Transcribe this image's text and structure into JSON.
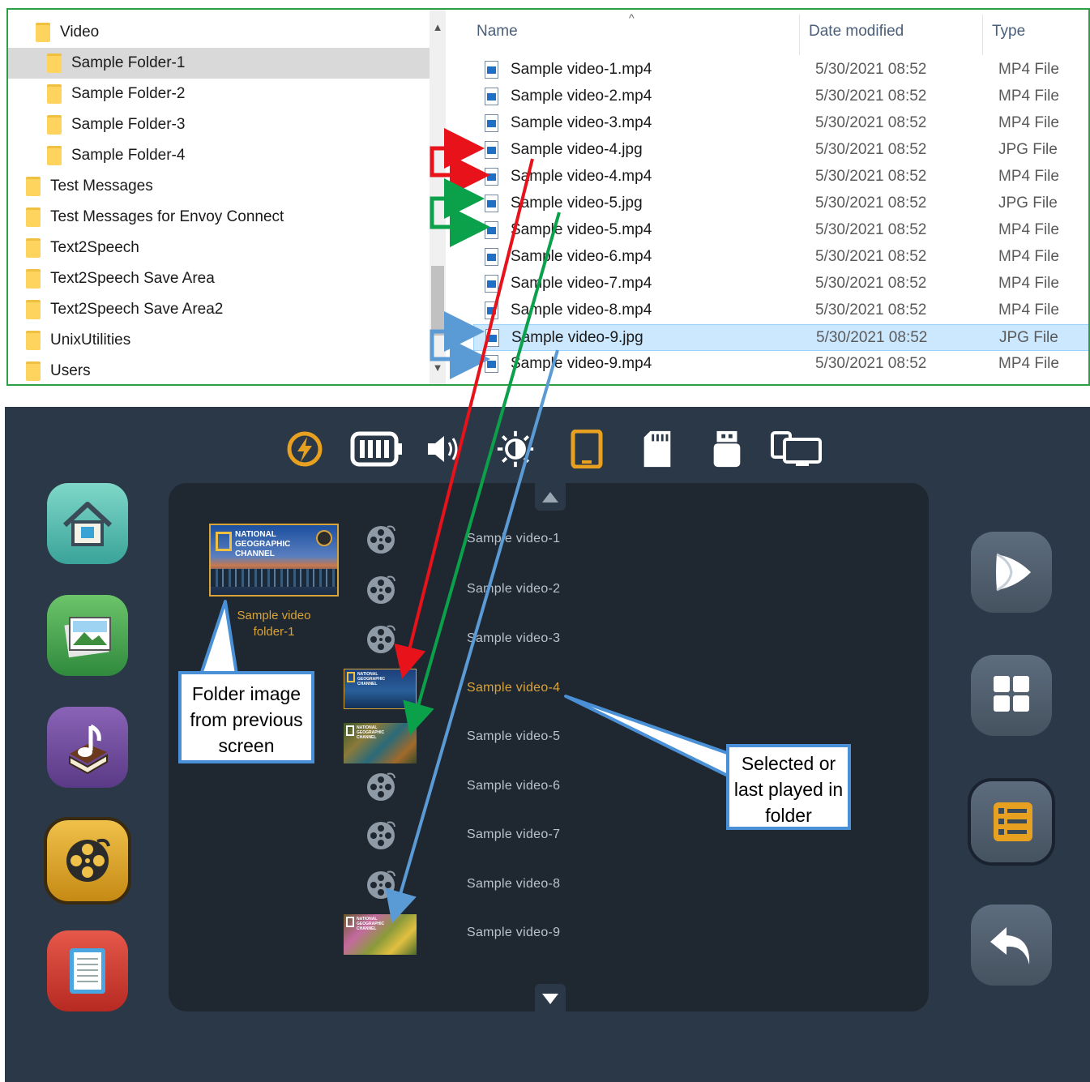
{
  "tree": {
    "items": [
      {
        "label": "Video",
        "level": 0,
        "selected": false
      },
      {
        "label": "Sample Folder-1",
        "level": 1,
        "selected": true
      },
      {
        "label": "Sample Folder-2",
        "level": 1,
        "selected": false
      },
      {
        "label": "Sample Folder-3",
        "level": 1,
        "selected": false
      },
      {
        "label": "Sample Folder-4",
        "level": 1,
        "selected": false
      },
      {
        "label": "Test Messages",
        "level": 0,
        "selected": false
      },
      {
        "label": "Test Messages for Envoy Connect",
        "level": 0,
        "selected": false
      },
      {
        "label": "Text2Speech",
        "level": 0,
        "selected": false
      },
      {
        "label": "Text2Speech Save Area",
        "level": 0,
        "selected": false
      },
      {
        "label": "Text2Speech Save Area2",
        "level": 0,
        "selected": false
      },
      {
        "label": "UnixUtilities",
        "level": 0,
        "selected": false
      },
      {
        "label": "Users",
        "level": 0,
        "selected": false
      }
    ]
  },
  "list": {
    "headers": {
      "name": "Name",
      "date": "Date modified",
      "type": "Type"
    },
    "files": [
      {
        "name": "Sample video-1.mp4",
        "date": "5/30/2021 08:52",
        "type": "MP4 File",
        "selected": false
      },
      {
        "name": "Sample video-2.mp4",
        "date": "5/30/2021 08:52",
        "type": "MP4 File",
        "selected": false
      },
      {
        "name": "Sample video-3.mp4",
        "date": "5/30/2021 08:52",
        "type": "MP4 File",
        "selected": false
      },
      {
        "name": "Sample video-4.jpg",
        "date": "5/30/2021 08:52",
        "type": "JPG File",
        "selected": false
      },
      {
        "name": "Sample video-4.mp4",
        "date": "5/30/2021 08:52",
        "type": "MP4 File",
        "selected": false
      },
      {
        "name": "Sample video-5.jpg",
        "date": "5/30/2021 08:52",
        "type": "JPG File",
        "selected": false
      },
      {
        "name": "Sample video-5.mp4",
        "date": "5/30/2021 08:52",
        "type": "MP4 File",
        "selected": false
      },
      {
        "name": "Sample video-6.mp4",
        "date": "5/30/2021 08:52",
        "type": "MP4 File",
        "selected": false
      },
      {
        "name": "Sample video-7.mp4",
        "date": "5/30/2021 08:52",
        "type": "MP4 File",
        "selected": false
      },
      {
        "name": "Sample video-8.mp4",
        "date": "5/30/2021 08:52",
        "type": "MP4 File",
        "selected": false
      },
      {
        "name": "Sample video-9.jpg",
        "date": "5/30/2021 08:52",
        "type": "JPG File",
        "selected": true
      },
      {
        "name": "Sample video-9.mp4",
        "date": "5/30/2021 08:52",
        "type": "MP4 File",
        "selected": false
      }
    ]
  },
  "device": {
    "status_icons": [
      "lightning-icon",
      "battery-icon",
      "speaker-icon",
      "brightness-icon",
      "tablet-icon",
      "sd-card-icon",
      "usb-drive-icon",
      "screen-mirror-icon"
    ],
    "left_buttons": [
      "home-icon",
      "gallery-icon",
      "music-book-icon",
      "video-reel-icon",
      "document-icon"
    ],
    "right_buttons": [
      "play-icon",
      "grid-view-icon",
      "list-view-icon",
      "back-icon"
    ],
    "folder": {
      "thumb_text": "NATIONAL\nGEOGRAPHIC\nCHANNEL",
      "caption": "Sample video folder-1"
    },
    "items": [
      {
        "label": "Sample video-1",
        "thumb": "reel",
        "active": false
      },
      {
        "label": "Sample video-2",
        "thumb": "reel",
        "active": false
      },
      {
        "label": "Sample video-3",
        "thumb": "reel",
        "active": false
      },
      {
        "label": "Sample video-4",
        "thumb": "image",
        "active": true
      },
      {
        "label": "Sample video-5",
        "thumb": "image",
        "active": false
      },
      {
        "label": "Sample video-6",
        "thumb": "reel",
        "active": false
      },
      {
        "label": "Sample video-7",
        "thumb": "reel",
        "active": false
      },
      {
        "label": "Sample video-8",
        "thumb": "reel",
        "active": false
      },
      {
        "label": "Sample video-9",
        "thumb": "image",
        "active": false
      }
    ],
    "thumb_brand": "NATIONAL GEOGRAPHIC CHANNEL"
  },
  "callouts": {
    "folder_image": "Folder image from previous screen",
    "selected": "Selected or last played in folder"
  },
  "colors": {
    "accent": "#d8a43a",
    "device_bg": "#2b3847",
    "panel_bg": "#1f2731",
    "arrow_red": "#e8121a",
    "arrow_green": "#0aa14a",
    "arrow_blue": "#5b9bd5",
    "frame_green": "#2e9e45"
  }
}
